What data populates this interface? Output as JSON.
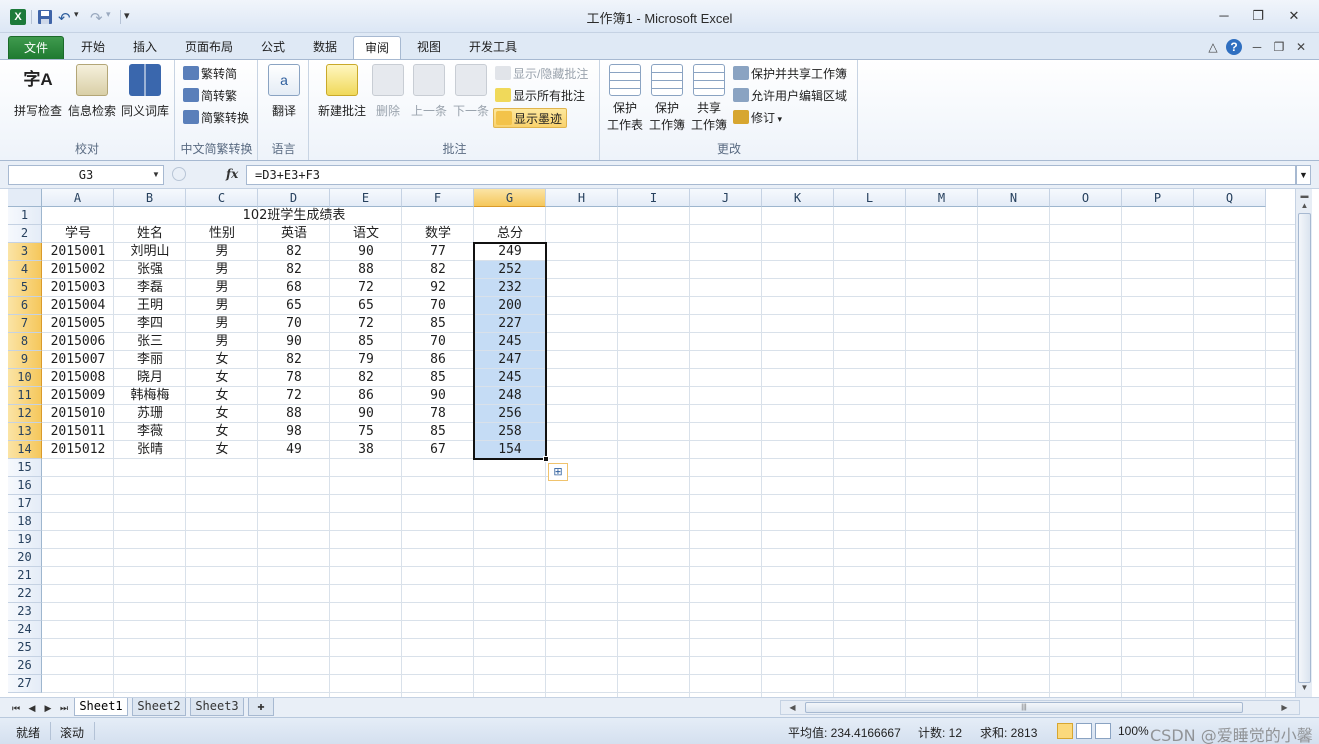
{
  "window": {
    "title": "工作簿1 - Microsoft Excel",
    "minimize": "─",
    "restore": "❐",
    "close": "✕"
  },
  "quick_access": {
    "app_icon": "X",
    "undo": "↶",
    "redo": "↷",
    "customize": "▾"
  },
  "ribbon_tabs": [
    "文件",
    "开始",
    "插入",
    "页面布局",
    "公式",
    "数据",
    "审阅",
    "视图",
    "开发工具"
  ],
  "active_tab": "审阅",
  "ribbon_groups": {
    "proofing": {
      "label": "校对",
      "buttons": [
        "拼写检查",
        "信息检索",
        "同义词库"
      ]
    },
    "chinese_conversion": {
      "label": "中文简繁转换",
      "buttons": [
        "繁转简",
        "简转繁",
        "简繁转换"
      ]
    },
    "language": {
      "label": "语言",
      "buttons": [
        "翻译"
      ]
    },
    "comments": {
      "label": "批注",
      "buttons": [
        "新建批注",
        "删除",
        "上一条",
        "下一条"
      ],
      "small": [
        "显示/隐藏批注",
        "显示所有批注",
        "显示墨迹"
      ]
    },
    "changes": {
      "label": "更改",
      "big": [
        [
          "保护",
          "工作表"
        ],
        [
          "保护",
          "工作簿"
        ],
        [
          "共享",
          "工作簿"
        ]
      ],
      "small": [
        "保护并共享工作簿",
        "允许用户编辑区域",
        "修订"
      ]
    }
  },
  "formula_bar": {
    "name_box": "G3",
    "fx": "fx",
    "formula": "=D3+E3+F3"
  },
  "grid": {
    "columns": [
      "A",
      "B",
      "C",
      "D",
      "E",
      "F",
      "G",
      "H",
      "I",
      "J",
      "K",
      "L",
      "M",
      "N",
      "O",
      "P",
      "Q"
    ],
    "selected_column": "G",
    "row_numbers": [
      "1",
      "2",
      "3",
      "4",
      "5",
      "6",
      "7",
      "8",
      "9",
      "10",
      "11",
      "12",
      "13",
      "14",
      "15",
      "16",
      "17",
      "18",
      "19",
      "20",
      "21",
      "22",
      "23",
      "24",
      "25",
      "26",
      "27"
    ],
    "selected_rows": [
      3,
      14
    ],
    "title": "102班学生成绩表",
    "headers": [
      "学号",
      "姓名",
      "性别",
      "英语",
      "语文",
      "数学",
      "总分"
    ],
    "rows": [
      [
        "2015001",
        "刘明山",
        "男",
        "82",
        "90",
        "77",
        "249"
      ],
      [
        "2015002",
        "张强",
        "男",
        "82",
        "88",
        "82",
        "252"
      ],
      [
        "2015003",
        "李磊",
        "男",
        "68",
        "72",
        "92",
        "232"
      ],
      [
        "2015004",
        "王明",
        "男",
        "65",
        "65",
        "70",
        "200"
      ],
      [
        "2015005",
        "李四",
        "男",
        "70",
        "72",
        "85",
        "227"
      ],
      [
        "2015006",
        "张三",
        "男",
        "90",
        "85",
        "70",
        "245"
      ],
      [
        "2015007",
        "李丽",
        "女",
        "82",
        "79",
        "86",
        "247"
      ],
      [
        "2015008",
        "晓月",
        "女",
        "78",
        "82",
        "85",
        "245"
      ],
      [
        "2015009",
        "韩梅梅",
        "女",
        "72",
        "86",
        "90",
        "248"
      ],
      [
        "2015010",
        "苏珊",
        "女",
        "88",
        "90",
        "78",
        "256"
      ],
      [
        "2015011",
        "李薇",
        "女",
        "98",
        "75",
        "85",
        "258"
      ],
      [
        "2015012",
        "张晴",
        "女",
        "49",
        "38",
        "67",
        "154"
      ]
    ]
  },
  "sheets": [
    "Sheet1",
    "Sheet2",
    "Sheet3"
  ],
  "active_sheet": "Sheet1",
  "status": {
    "mode": "就绪",
    "scroll_lock": "滚动",
    "average": "平均值: 234.4166667",
    "count": "计数: 12",
    "sum": "求和: 2813",
    "zoom": "100%"
  },
  "watermark": "CSDN @爱睡觉的小馨",
  "colors": {
    "selection_fill": "#c5dcf5",
    "header_selected": "#f5c75b",
    "file_tab": "#1f7a30",
    "accent": "#2f6fc0"
  }
}
